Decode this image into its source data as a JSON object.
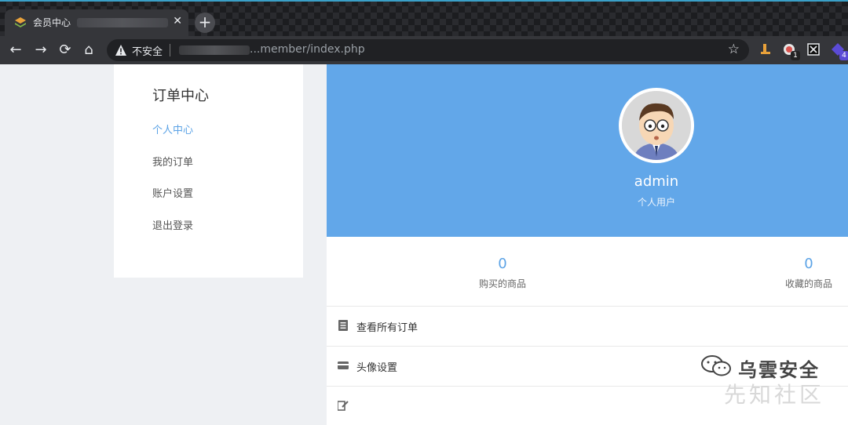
{
  "browser": {
    "tab_title": "会员中心",
    "address_security": "不安全",
    "address_url": "...member/index.php",
    "extensions": [
      {
        "badge": ""
      },
      {
        "badge": "1"
      },
      {
        "badge": ""
      },
      {
        "badge": "4"
      }
    ]
  },
  "sidebar": {
    "title": "订单中心",
    "items": [
      {
        "label": "个人中心",
        "active": true
      },
      {
        "label": "我的订单",
        "active": false
      },
      {
        "label": "账户设置",
        "active": false
      },
      {
        "label": "退出登录",
        "active": false
      }
    ]
  },
  "profile": {
    "username": "admin",
    "user_type": "个人用户"
  },
  "stats": [
    {
      "value": "0",
      "label": "购买的商品"
    },
    {
      "value": "0",
      "label": "收藏的商品"
    }
  ],
  "menu": [
    {
      "label": "查看所有订单",
      "icon": "document-icon"
    },
    {
      "label": "头像设置",
      "icon": "card-icon"
    },
    {
      "label": "",
      "icon": "edit-icon"
    }
  ],
  "watermark": {
    "text": "乌雲安全",
    "faint_text": "先知社区"
  },
  "colors": {
    "hero": "#62a7e9",
    "accent": "#5ca3e6"
  }
}
